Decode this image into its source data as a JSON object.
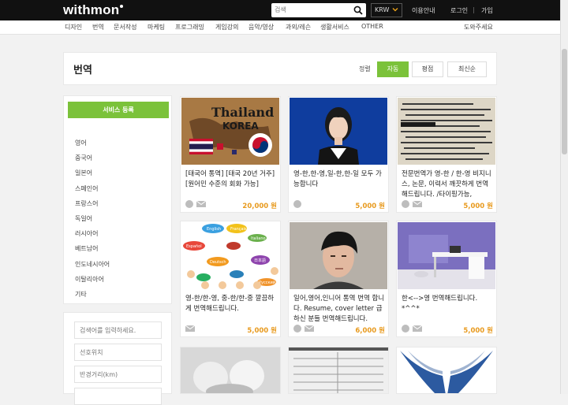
{
  "header": {
    "logo": "withmon",
    "search_placeholder": "검색",
    "currency": "KRW",
    "links": [
      "이용안내",
      "로그인",
      "가입"
    ],
    "separator": "|"
  },
  "categories": [
    "디자인",
    "번역",
    "문서작성",
    "마케팅",
    "프로그래밍",
    "게임강의",
    "음악/영상",
    "과외/레슨",
    "생활서비스",
    "OTHER"
  ],
  "help": "도와주세요",
  "page": {
    "title": "번역",
    "sort_label": "정렬",
    "sort_options": [
      "자동",
      "평점",
      "최신순"
    ]
  },
  "sidebar": {
    "register_button": "서비스 등록",
    "languages": [
      "영어",
      "중국어",
      "일본어",
      "스페인어",
      "프랑스어",
      "독일어",
      "러시아어",
      "베트남어",
      "인도네시아어",
      "이탈리아어",
      "기타"
    ],
    "filters": [
      "검색어를 입력하세요.",
      "선호위치",
      "반경거리(km)"
    ]
  },
  "cards": [
    {
      "title": "[태국어 통역] [태국 20년 거주] [원어민 수준의 회화 가능]",
      "price": "20,000 원",
      "image": "thailand-korea-flags",
      "image_text": [
        "Thailand",
        "KOREA"
      ]
    },
    {
      "title": "영-한,한-영,일-한,한-일 모두 가능합니다",
      "price": "5,000 원",
      "image": "portrait-woman"
    },
    {
      "title": "전문번역가 영-한 / 한-영 비지니스, 논문, 이력서 깨끗하게 번역해드립니다. /타이핑가능,",
      "price": "5,000 원",
      "image": "dictionary-page"
    },
    {
      "title": "영-한/한-영, 중-한/한-중 깔끔하게 번역해드립니다.",
      "price": "5,000 원",
      "image": "hello-speech-bubbles",
      "image_text": [
        "English",
        "Français",
        "Español",
        "Deutsch",
        "日本語",
        "Italiano",
        "Русский"
      ]
    },
    {
      "title": "일어,영어,인니어 통역 번역 합니다. Resume, cover letter 급하신 분들 번역해드립니다.",
      "price": "6,000 원",
      "image": "portrait-man"
    },
    {
      "title": "한<-->영 번역해드립니다. *^^*",
      "price": "5,000 원",
      "image": "office-desk"
    }
  ],
  "colors": {
    "accent": "#7bc23a",
    "price": "#e89a1e",
    "topbar": "#111111"
  }
}
